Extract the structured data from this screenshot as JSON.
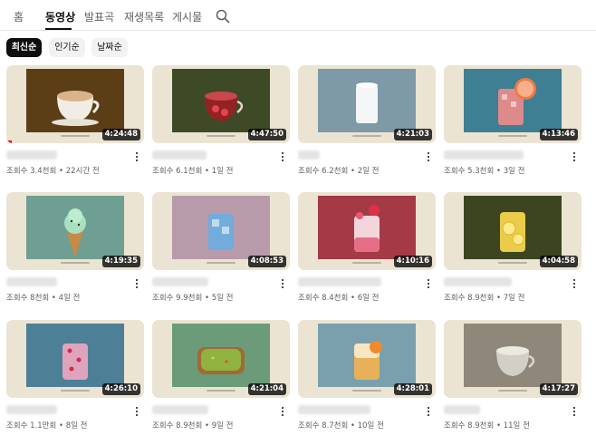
{
  "tabs": [
    {
      "label": "홈"
    },
    {
      "label": "동영상",
      "active": true
    },
    {
      "label": "발표곡"
    },
    {
      "label": "재생목록"
    },
    {
      "label": "게시물"
    }
  ],
  "search_icon": "search-icon",
  "sort_chips": [
    {
      "label": "최신순",
      "selected": true
    },
    {
      "label": "인기순"
    },
    {
      "label": "날짜순"
    }
  ],
  "videos": [
    {
      "duration": "4:24:48",
      "meta": "조회수 3.4천회 • 22시간 전",
      "subject": "latte-cup",
      "bg": "#5b3e16",
      "watched_fraction": 0.04
    },
    {
      "duration": "4:47:50",
      "meta": "조회수 6.1천회 • 1일 전",
      "subject": "berry-tea-cup",
      "bg": "#3e4a26"
    },
    {
      "duration": "4:21:03",
      "meta": "조회수 6.2천회 • 2일 전",
      "subject": "milk-glass",
      "bg": "#7d9aa6"
    },
    {
      "duration": "4:13:46",
      "meta": "조회수 5.3천회 • 3일 전",
      "subject": "grapefruit-soda",
      "bg": "#3f7f93"
    },
    {
      "duration": "4:19:35",
      "meta": "조회수 8천회 • 4일 전",
      "subject": "mint-ice-cream-cone",
      "bg": "#6f9f92"
    },
    {
      "duration": "4:08:53",
      "meta": "조회수 9.9천회 • 5일 전",
      "subject": "blue-ice-drink",
      "bg": "#b79bab"
    },
    {
      "duration": "4:10:16",
      "meta": "조회수 8.4천회 • 6일 전",
      "subject": "strawberry-milk",
      "bg": "#a33a46"
    },
    {
      "duration": "4:04:58",
      "meta": "조회수 8.9천회 • 7일 전",
      "subject": "lemonade",
      "bg": "#3c4520"
    },
    {
      "duration": "4:26:10",
      "meta": "조회수 1.1만회 • 8일 전",
      "subject": "pink-berry-soda",
      "bg": "#4d7f97"
    },
    {
      "duration": "4:21:04",
      "meta": "조회수 8.9천회 • 9일 전",
      "subject": "avocado-toast",
      "bg": "#6b9b78"
    },
    {
      "duration": "4:28:01",
      "meta": "조회수 8.7천회 • 10일 전",
      "subject": "orange-iced-drink",
      "bg": "#7aa0ad"
    },
    {
      "duration": "4:17:27",
      "meta": "조회수 8.9천회 • 11일 전",
      "subject": "clear-tea-cup",
      "bg": "#8e877a"
    }
  ]
}
